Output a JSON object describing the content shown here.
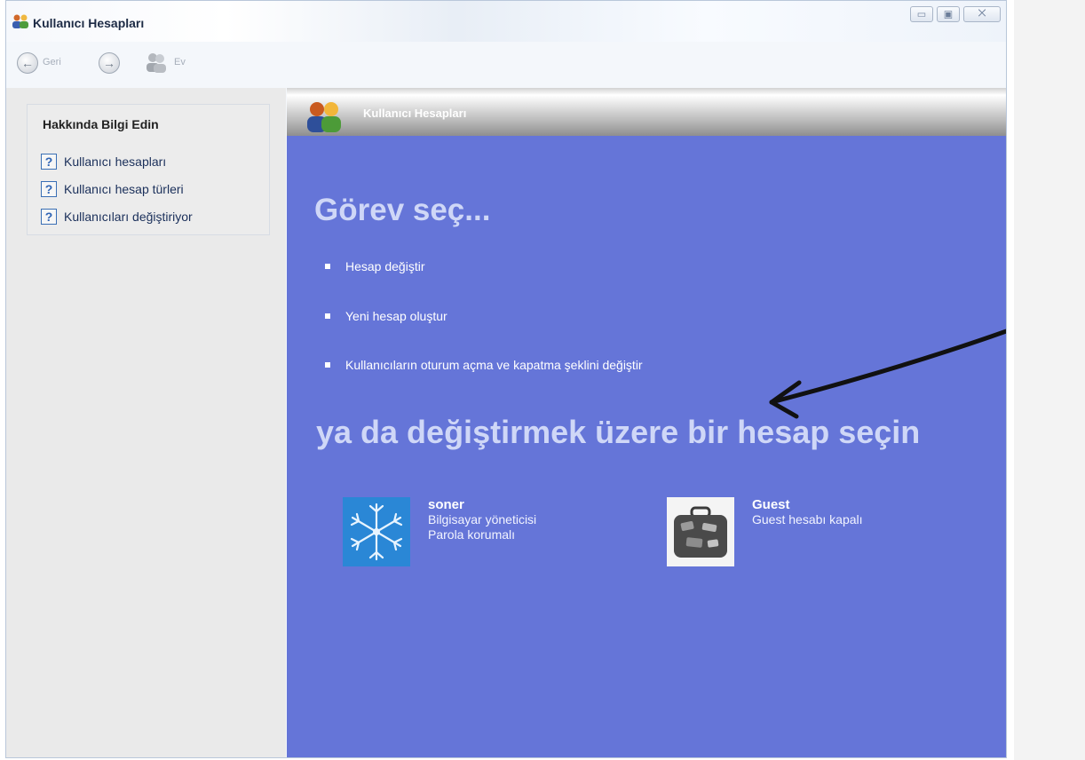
{
  "window": {
    "title": "Kullanıcı Hesapları",
    "buttons": {
      "minimize": "▭",
      "maximize": "▣",
      "close": "⨉"
    }
  },
  "nav": {
    "back_label": "Geri",
    "forward_label": "",
    "home_label": "Ev"
  },
  "sidebar": {
    "title": "Hakkında Bilgi Edin",
    "items": [
      {
        "label": "Kullanıcı hesapları",
        "icon": "help-icon"
      },
      {
        "label": "Kullanıcı hesap türleri",
        "icon": "help-icon"
      },
      {
        "label": "Kullanıcıları değiştiriyor",
        "icon": "help-icon"
      }
    ]
  },
  "main": {
    "header_title": "Kullanıcı Hesapları",
    "task_heading": "Görev seç...",
    "tasks": [
      {
        "label": "Hesap değiştir"
      },
      {
        "label": "Yeni hesap oluştur"
      },
      {
        "label": "Kullanıcıların oturum açma ve kapatma şeklini değiştir"
      }
    ],
    "accounts_heading": "ya da değiştirmek üzere bir hesap seçin",
    "accounts": [
      {
        "name": "soner",
        "line1": "Bilgisayar yöneticisi",
        "line2": "Parola korumalı",
        "picture": "snowflake-picture"
      },
      {
        "name": "Guest",
        "line1": "Guest hesabı kapalı",
        "line2": "",
        "picture": "suitcase-picture"
      }
    ]
  },
  "colors": {
    "main_bg": "#6575d8",
    "sidebar_bg": "#eaeaea",
    "heading_text": "#cfd7f7"
  }
}
